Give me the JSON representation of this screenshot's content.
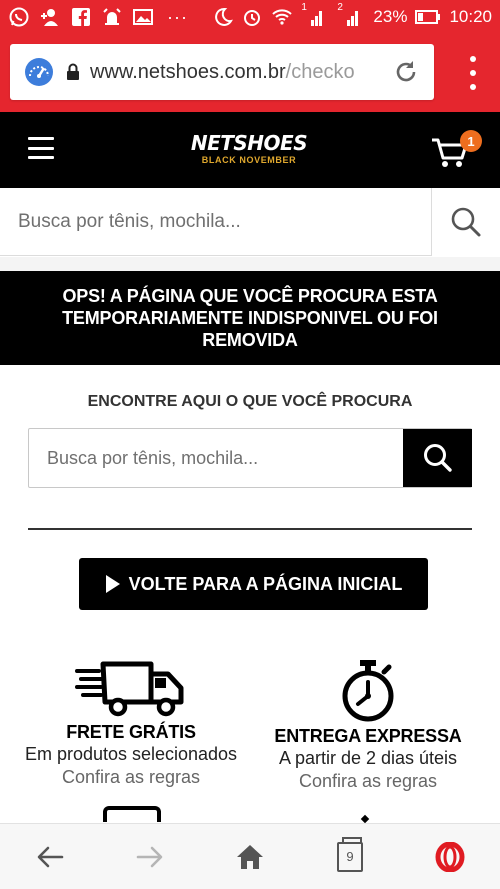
{
  "status_bar": {
    "signal_1": "1",
    "signal_2": "2",
    "battery": "23%",
    "time": "10:20",
    "bg_color": "#e5262e"
  },
  "browser": {
    "url_main": "www.netshoes.com.br",
    "url_dim": "/checko",
    "icons": [
      "speed-dial-icon",
      "lock-icon",
      "reload-icon",
      "menu-icon"
    ]
  },
  "header": {
    "logo_text": "NETSHOES",
    "logo_sub": "BLACK NOVEMBER",
    "cart_count": "1",
    "accent_color": "#ee6e1f"
  },
  "top_search": {
    "placeholder": "Busca por tênis, mochila..."
  },
  "error": {
    "message": "OPS! A PÁGINA QUE VOCÊ PROCURA ESTA TEMPORARIAMENTE INDISPONIVEL OU FOI REMOVIDA"
  },
  "find": {
    "title": "ENCONTRE AQUI O QUE VOCÊ PROCURA",
    "placeholder": "Busca por tênis, mochila..."
  },
  "home_button": {
    "label": "VOLTE PARA A PÁGINA INICIAL"
  },
  "benefits": {
    "free": {
      "title": "FRETE GRÁTIS",
      "subtitle": "Em produtos selecionados",
      "link": "Confira as regras"
    },
    "express": {
      "title": "ENTREGA EXPRESSA",
      "subtitle": "A partir de 2 dias úteis",
      "link": "Confira as regras"
    }
  },
  "bottom_nav": {
    "tabs_count": "9"
  }
}
